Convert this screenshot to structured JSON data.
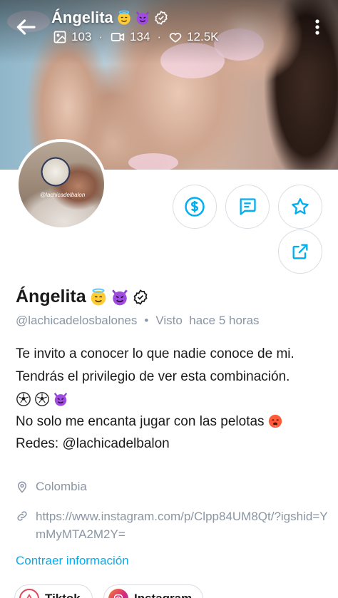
{
  "header": {
    "name": "Ángelita",
    "stats": {
      "posts": "103",
      "videos": "134",
      "likes": "12.5K"
    }
  },
  "profile": {
    "name": "Ángelita",
    "handle": "@lachicadelosbalones",
    "separator": "•",
    "last_seen": "Visto  hace 5 horas",
    "avatar_watermark": "@lachicadelbalon",
    "bio": {
      "line1": "Te invito a conocer lo que nadie conoce de mi.",
      "line2": "Tendrás el privilegio de ver esta combinación.",
      "line4": "No solo me encanta jugar con las pelotas",
      "line5": "Redes: @lachicadelbalon"
    },
    "location": "Colombia",
    "link": "https://www.instagram.com/p/Clpp84UM8Qt/?igshid=YmMyMTA2M2Y=",
    "collapse_label": "Contraer información"
  },
  "socials": [
    {
      "label": "Tiktok"
    },
    {
      "label": "Instagram"
    }
  ],
  "icons": {
    "back": "arrow-left-icon",
    "menu": "more-vertical-icon",
    "posts": "image-icon",
    "videos": "video-icon",
    "likes": "heart-icon",
    "verified": "verified-badge-icon",
    "tip": "dollar-icon",
    "message": "message-icon",
    "favorite": "star-icon",
    "share": "share-icon",
    "location": "location-pin-icon",
    "link": "link-icon"
  },
  "colors": {
    "accent": "#00aff0",
    "muted": "#8a96a3",
    "text": "#1a1a1a",
    "border": "#d9dde3"
  }
}
